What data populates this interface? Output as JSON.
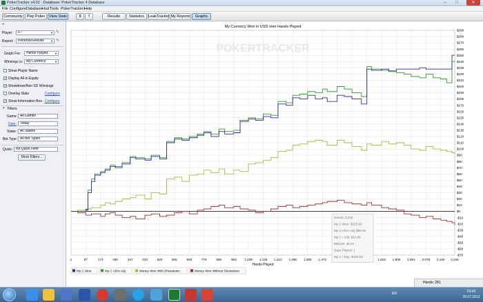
{
  "window": {
    "title": "PokerTracker v4.02 - Database: PokerTracker 4 Database",
    "controls": [
      "–",
      "□",
      "✕"
    ]
  },
  "menu": [
    "File",
    "Configure",
    "Database",
    "Hud",
    "Tools",
    "PokerTracker+",
    "Help"
  ],
  "toolbar": {
    "buttons": [
      "Community",
      "Play Poker",
      "View Stats"
    ],
    "currency_buttons": [
      "$",
      "T"
    ],
    "tabs": [
      "Results",
      "Statistics",
      "LeakTracker",
      "My Reports",
      "Graphs"
    ],
    "active_tab": "Graphs"
  },
  "filters_panel": {
    "player_label": "Player:",
    "player_value": "♠ • -",
    "report_label": "Report:",
    "report_value": "Personal Results",
    "graph_for_label": "Graph For:",
    "graph_for_value": "Hands Played",
    "winnings_in_label": "Winnings in:",
    "winnings_in_value": "My Currency",
    "checkboxes": [
      {
        "label": "Show Player Name",
        "checked": false
      },
      {
        "label": "Display All-in Equity",
        "checked": true
      },
      {
        "label": "Showdown/Non SD Winnings",
        "checked": true
      },
      {
        "label": "Overlay Stats",
        "checked": false,
        "link": "Configure"
      },
      {
        "label": "Show Information Box",
        "checked": true,
        "link": "Configure"
      }
    ],
    "filters_header": "Filters",
    "game_label": "Game:",
    "game_value": "All Games",
    "date_label": "Date:",
    "date_value": "Today",
    "stake_label": "Stake:",
    "stake_value": "All Stakes",
    "bettype_label": "Bet Type:",
    "bettype_value": "All Bet Types",
    "quick_label": "Quick:",
    "quick_value": "No Quick Filter",
    "more_filters": "More Filters..."
  },
  "chart_data": {
    "type": "line",
    "title": "My Currency Won in USD over Hands Played",
    "watermark": "POKERTRACKER",
    "xlabel": "Hands Played",
    "ylabel": "",
    "xlim": [
      1,
      2246
    ],
    "ylim": [
      -70,
      290
    ],
    "x_ticks": [
      1,
      87,
      174,
      260,
      347,
      433,
      520,
      606,
      693,
      779,
      866,
      953,
      1039,
      1126,
      1212,
      1298,
      1385,
      1472,
      1558,
      1645,
      1732,
      1818,
      1905,
      1991,
      2078,
      2164,
      2246
    ],
    "y_ticks": [
      -70,
      -60,
      -50,
      -40,
      -30,
      -20,
      -10,
      0,
      10,
      20,
      30,
      40,
      50,
      60,
      70,
      80,
      90,
      100,
      110,
      120,
      130,
      140,
      150,
      160,
      170,
      180,
      190,
      200,
      210,
      220,
      230,
      240,
      250,
      260,
      270,
      280,
      290
    ],
    "y_tick_prefix": "$",
    "grid": true,
    "legend_position": "bottom",
    "series": [
      {
        "name": "My C Won",
        "color": "#2a2aa8",
        "x": [
          1,
          40,
          87,
          100,
          120,
          140,
          174,
          200,
          230,
          260,
          300,
          347,
          380,
          433,
          470,
          520,
          560,
          606,
          650,
          693,
          740,
          779,
          820,
          866,
          900,
          953,
          990,
          1039,
          1080,
          1126,
          1170,
          1212,
          1260,
          1298,
          1340,
          1385,
          1430,
          1472,
          1500,
          1558,
          1600,
          1645,
          1700,
          1732,
          1760,
          1818,
          1860,
          1905,
          1950,
          1991,
          2040,
          2078,
          2120,
          2164,
          2200,
          2230,
          2246
        ],
        "y": [
          0,
          0,
          2,
          30,
          48,
          58,
          62,
          66,
          72,
          70,
          76,
          86,
          84,
          82,
          88,
          84,
          110,
          116,
          114,
          118,
          122,
          126,
          120,
          128,
          124,
          126,
          144,
          148,
          146,
          152,
          150,
          172,
          170,
          182,
          180,
          186,
          180,
          182,
          176,
          186,
          184,
          180,
          172,
          228,
          226,
          228,
          225,
          228,
          228,
          228,
          230,
          228,
          228,
          228,
          228,
          250,
          250
        ]
      },
      {
        "name": "My C All-in Adj.",
        "color": "#2f9a2f",
        "x": [
          1,
          40,
          87,
          100,
          120,
          140,
          174,
          200,
          230,
          260,
          300,
          347,
          380,
          433,
          470,
          520,
          560,
          606,
          650,
          693,
          740,
          779,
          820,
          866,
          900,
          953,
          990,
          1039,
          1080,
          1126,
          1170,
          1212,
          1260,
          1298,
          1340,
          1385,
          1430,
          1472,
          1500,
          1558,
          1600,
          1645,
          1700,
          1732,
          1760,
          1818,
          1860,
          1905,
          1950,
          1991,
          2040,
          2078,
          2120,
          2164,
          2200,
          2230,
          2246
        ],
        "y": [
          0,
          0,
          3,
          34,
          52,
          60,
          64,
          68,
          74,
          72,
          78,
          88,
          86,
          84,
          90,
          86,
          112,
          118,
          116,
          120,
          124,
          128,
          124,
          132,
          128,
          130,
          146,
          150,
          148,
          156,
          154,
          176,
          174,
          186,
          188,
          192,
          190,
          196,
          192,
          200,
          196,
          190,
          184,
          232,
          228,
          226,
          224,
          222,
          220,
          216,
          214,
          220,
          214,
          212,
          206,
          240,
          242
        ]
      },
      {
        "name": "Money Won With Showdown",
        "color": "#a9b83a",
        "x": [
          1,
          40,
          87,
          120,
          174,
          200,
          230,
          260,
          300,
          347,
          380,
          433,
          470,
          520,
          560,
          606,
          650,
          693,
          740,
          779,
          820,
          866,
          900,
          953,
          990,
          1039,
          1080,
          1126,
          1170,
          1212,
          1260,
          1298,
          1340,
          1385,
          1430,
          1472,
          1500,
          1558,
          1600,
          1645,
          1700,
          1732,
          1760,
          1818,
          1860,
          1905,
          1950,
          1991,
          2040,
          2078,
          2120,
          2164,
          2200,
          2230,
          2246
        ],
        "y": [
          0,
          2,
          4,
          6,
          10,
          14,
          12,
          16,
          20,
          22,
          26,
          20,
          30,
          28,
          52,
          55,
          48,
          58,
          60,
          66,
          62,
          68,
          60,
          66,
          64,
          76,
          78,
          82,
          86,
          96,
          98,
          106,
          108,
          112,
          114,
          112,
          106,
          114,
          110,
          104,
          98,
          108,
          106,
          112,
          108,
          110,
          106,
          100,
          98,
          104,
          100,
          98,
          96,
          94,
          92
        ]
      },
      {
        "name": "Money Won Without Showdown",
        "color": "#a02a2a",
        "x": [
          1,
          40,
          87,
          120,
          174,
          200,
          230,
          260,
          300,
          347,
          380,
          433,
          470,
          520,
          560,
          606,
          650,
          693,
          740,
          779,
          820,
          866,
          900,
          953,
          990,
          1039,
          1080,
          1126,
          1170,
          1212,
          1260,
          1298,
          1340,
          1385,
          1430,
          1472,
          1500,
          1558,
          1600,
          1645,
          1700,
          1732,
          1760,
          1818,
          1860,
          1905,
          1950,
          1991,
          2040,
          2078,
          2120,
          2164,
          2200,
          2230,
          2246
        ],
        "y": [
          0,
          -2,
          -6,
          -4,
          -8,
          -4,
          -2,
          -6,
          -10,
          -8,
          -12,
          -6,
          -4,
          -8,
          -6,
          -2,
          0,
          -4,
          2,
          4,
          8,
          10,
          6,
          8,
          4,
          2,
          -2,
          0,
          4,
          8,
          10,
          6,
          8,
          10,
          12,
          14,
          16,
          18,
          14,
          12,
          10,
          14,
          10,
          6,
          4,
          2,
          -4,
          -6,
          -10,
          -8,
          -12,
          -14,
          -16,
          -18,
          -22
        ]
      }
    ],
    "info_box": [
      "Hands: 2,246",
      "My C Won: $225.92",
      "My C All-in Adj: $88.65",
      "My C / 100: $10.06",
      "BB/100: 48.24",
      "Days Played: 1",
      "My C / Day: $225.92"
    ]
  },
  "statusbar": {
    "hands_label": "Hands: 281"
  },
  "taskbar": {
    "time": "23:42",
    "date": "26.07.2012",
    "language": "EN"
  }
}
